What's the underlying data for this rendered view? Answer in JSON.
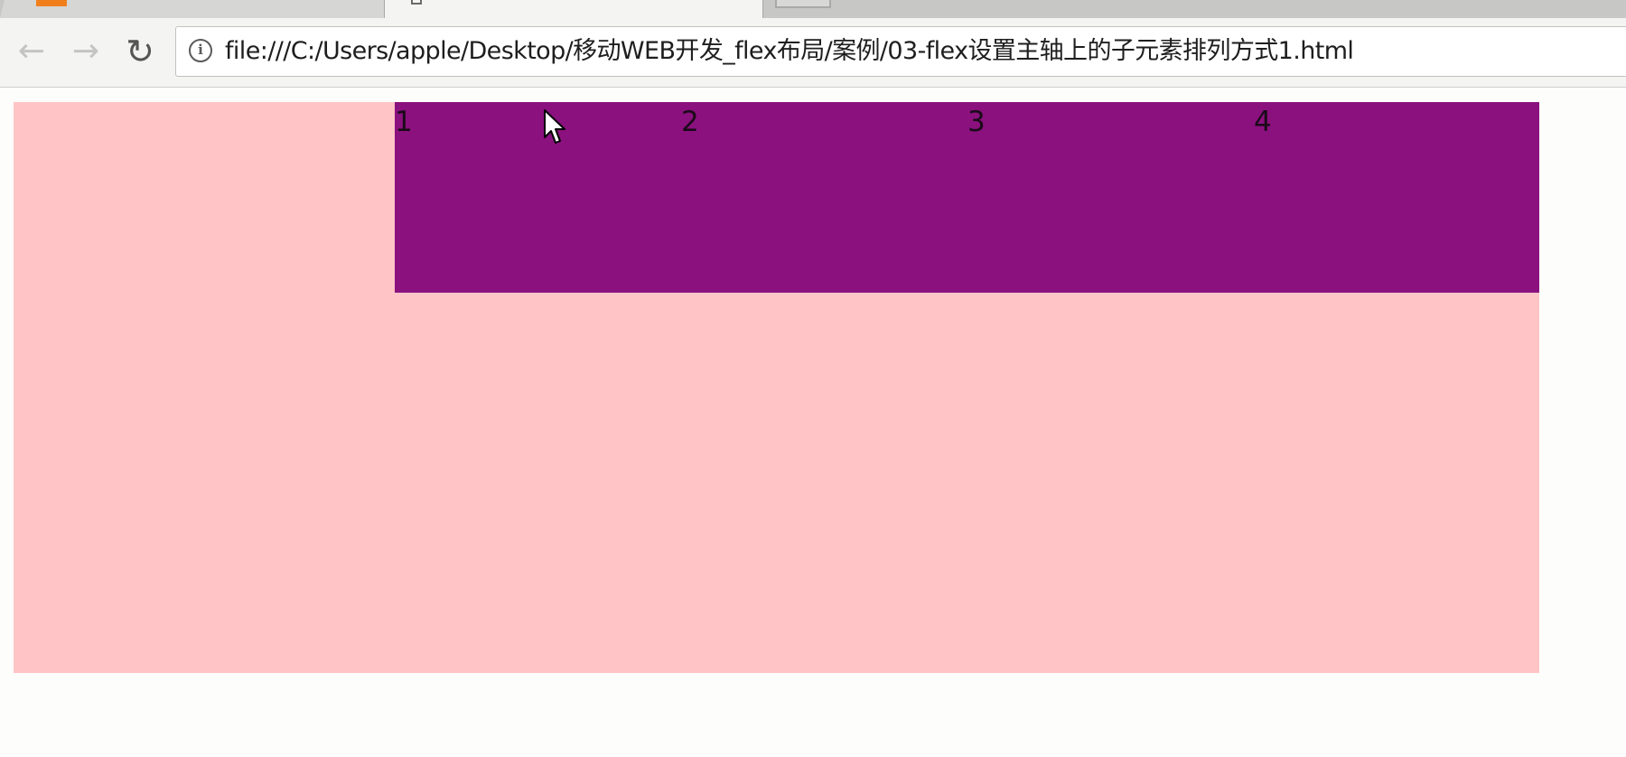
{
  "browser": {
    "address_bar": {
      "url": "file:///C:/Users/apple/Desktop/移动WEB开发_flex布局/案例/03-flex设置主轴上的子元素排列方式1.html"
    },
    "icons": {
      "back": "back-arrow-icon",
      "forward": "forward-arrow-icon",
      "reload": "reload-icon",
      "info": "info-icon"
    }
  },
  "page": {
    "container_color": "#ffc4c6",
    "box_color": "#8a117e",
    "items": [
      {
        "label": "1"
      },
      {
        "label": "2"
      },
      {
        "label": "3"
      },
      {
        "label": "4"
      }
    ]
  }
}
